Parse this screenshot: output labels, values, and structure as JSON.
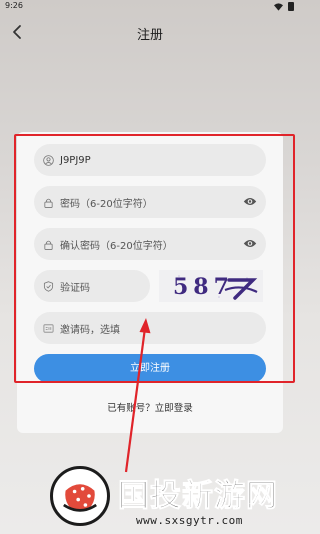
{
  "status_bar": {
    "time": "9:26"
  },
  "header": {
    "title": "注册"
  },
  "form": {
    "username_value": "J9PJ9P",
    "password_placeholder": "密码（6-20位字符）",
    "confirm_placeholder": "确认密码（6-20位字符）",
    "code_placeholder": "验证码",
    "captcha_text": "587",
    "invite_placeholder": "邀请码，选填",
    "submit_label": "立即注册",
    "login_prompt": "已有账号？立即登录"
  },
  "watermark": {
    "brand": "国投新游网",
    "url": "www.sxsgytr.com"
  },
  "colors": {
    "primary": "#3d8fe3",
    "annotation_red": "#e0242a"
  }
}
